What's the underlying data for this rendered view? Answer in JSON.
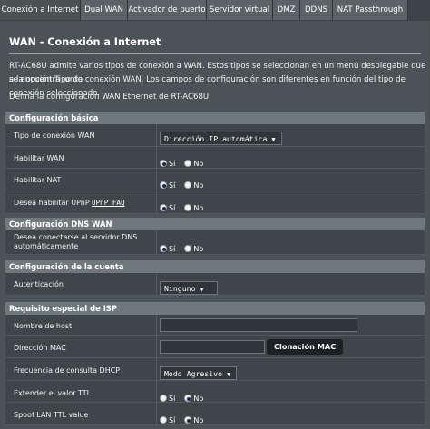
{
  "tabs": [
    {
      "label": "Conexión a Internet",
      "active": true
    },
    {
      "label": "Dual WAN",
      "active": false
    },
    {
      "label": "Activador de puerto",
      "active": false
    },
    {
      "label": "Servidor virtual",
      "active": false
    },
    {
      "label": "DMZ",
      "active": false
    },
    {
      "label": "DDNS",
      "active": false
    },
    {
      "label": "NAT Passthrough",
      "active": false
    }
  ],
  "page": {
    "title": "WAN - Conexión a Internet",
    "desc1": "RT-AC68U admite varios tipos de conexión a WAN. Estos tipos se seleccionan en un menú desplegable que se encuentra junto",
    "desc2": "a la opción Tipo de conexión WAN. Los campos de configuración son diferentes en función del tipo de conexión seleccionado.",
    "desc3": "Defina la configuración WAN Ethernet de RT-AC68U."
  },
  "radio": {
    "yes": "Sí",
    "no": "No"
  },
  "basic": {
    "header": "Configuración básica",
    "wan_type_label": "Tipo de conexión WAN",
    "wan_type_value": "Dirección IP automática",
    "enable_wan_label": "Habilitar WAN",
    "enable_nat_label": "Habilitar NAT",
    "upnp_label": "Desea habilitar UPnP",
    "upnp_faq": "UPnP FAQ"
  },
  "dns": {
    "header": "Configuración DNS WAN",
    "auto_dns_label": "Desea conectarse al servidor DNS automáticamente"
  },
  "account": {
    "header": "Configuración de la cuenta",
    "auth_label": "Autenticación",
    "auth_value": "Ninguno"
  },
  "isp": {
    "header": "Requisito especial de ISP",
    "hostname_label": "Nombre de host",
    "mac_label": "Dirección MAC",
    "clone_mac_button": "Clonación MAC",
    "dhcp_freq_label": "Frecuencia de consulta DHCP",
    "dhcp_freq_value": "Modo Agresivo",
    "ttl_label": "Extender el valor TTL",
    "spoof_ttl_label": "Spoof LAN TTL value"
  },
  "colors": {
    "background": "#4b5254",
    "section_header": "#6f787b",
    "row": "#3f4649",
    "field": "#2f3538",
    "button": "#1c2124"
  }
}
